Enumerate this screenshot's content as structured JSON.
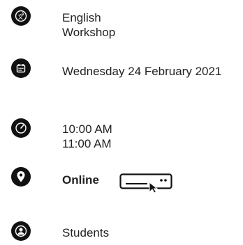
{
  "event": {
    "category": {
      "line1": "English",
      "line2": "Workshop",
      "icon": "language-translate-icon"
    },
    "date": {
      "text": "Wednesday 24 February 2021",
      "icon": "calendar-icon"
    },
    "time": {
      "start": "10:00 AM",
      "end": "11:00 AM",
      "icon": "clock-icon"
    },
    "location": {
      "text": "Online",
      "icon": "location-pin-icon",
      "widget_icon": "online-join-icon"
    },
    "audience": {
      "text": "Students",
      "icon": "user-icon"
    }
  },
  "colors": {
    "icon_bg": "#111111",
    "text": "#222222",
    "background": "#ffffff"
  }
}
